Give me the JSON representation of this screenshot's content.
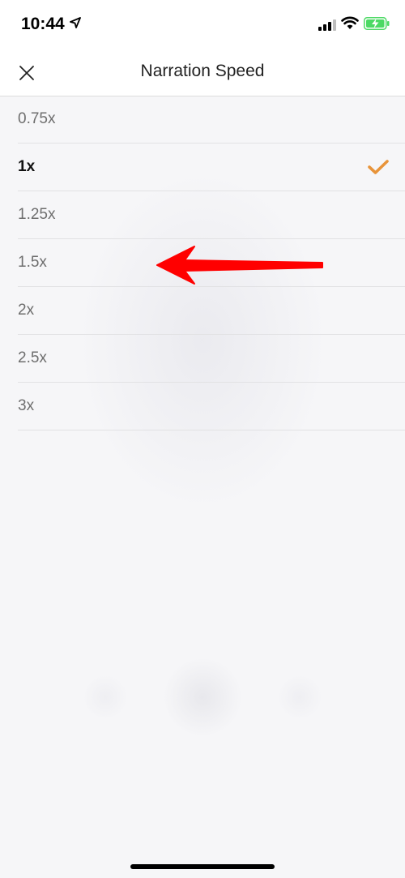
{
  "status_bar": {
    "time": "10:44",
    "icons": [
      "location-arrow-icon",
      "signal-icon",
      "wifi-icon",
      "battery-charging-icon"
    ]
  },
  "nav": {
    "title": "Narration Speed",
    "close_icon": "close-icon"
  },
  "speed_options": [
    {
      "label": "0.75x",
      "selected": false
    },
    {
      "label": "1x",
      "selected": true
    },
    {
      "label": "1.25x",
      "selected": false
    },
    {
      "label": "1.5x",
      "selected": false
    },
    {
      "label": "2x",
      "selected": false
    },
    {
      "label": "2.5x",
      "selected": false
    },
    {
      "label": "3x",
      "selected": false
    }
  ],
  "colors": {
    "accent_check": "#e8943a",
    "annotation_arrow": "#ff0000",
    "battery_fill": "#4cd964"
  }
}
